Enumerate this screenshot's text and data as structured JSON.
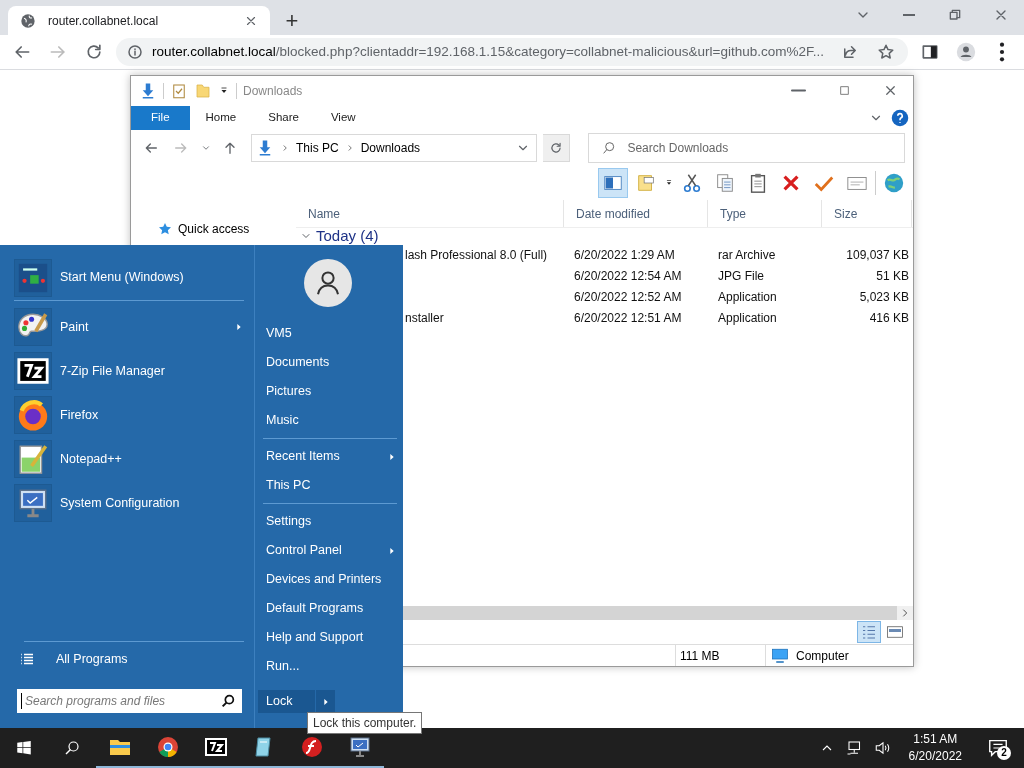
{
  "browser": {
    "tab_title": "router.collabnet.local",
    "new_tab": "+",
    "url_host": "router.collabnet.local",
    "url_path": "/blocked.php?clientaddr=192.168.1.15&category=collabnet-malicious&url=github.com%2F..."
  },
  "explorer": {
    "title": "Downloads",
    "ribbon_tabs": [
      {
        "label": "File",
        "selected": true
      },
      {
        "label": "Home",
        "selected": false
      },
      {
        "label": "Share",
        "selected": false
      },
      {
        "label": "View",
        "selected": false
      }
    ],
    "breadcrumb": [
      "This PC",
      "Downloads"
    ],
    "search": {
      "placeholder": "Search Downloads"
    },
    "preview_pane": {
      "on": true
    },
    "toolbar": [
      {
        "kind": "pane"
      },
      {
        "kind": "note"
      },
      {
        "kind": "cut"
      },
      {
        "kind": "copy"
      },
      {
        "kind": "paste"
      },
      {
        "kind": "delete"
      },
      {
        "kind": "check"
      },
      {
        "kind": "card"
      },
      {
        "kind": "globe"
      }
    ],
    "nav": [
      "Quick access"
    ],
    "columns": [
      "Name",
      "Date modified",
      "Type",
      "Size"
    ],
    "group": "Today (4)",
    "files": [
      {
        "name": "lash Professional 8.0 (Full)",
        "date": "6/20/2022 1:29 AM",
        "type": "rar Archive",
        "size": "109,037 KB"
      },
      {
        "date": "6/20/2022 12:54 AM",
        "type": "JPG File",
        "size": "51 KB"
      },
      {
        "date": "6/20/2022 12:52 AM",
        "type": "Application",
        "size": "5,023 KB"
      },
      {
        "name": "nstaller",
        "date": "6/20/2022 12:51 AM",
        "type": "Application",
        "size": "416 KB"
      }
    ],
    "views": [
      {
        "kind": "details",
        "selected": true
      },
      {
        "kind": "preview",
        "selected": false
      }
    ],
    "status": {
      "size": "111 MB",
      "zone": "Computer"
    }
  },
  "start_menu": {
    "pinned": [
      {
        "kind": "start",
        "label": "Start Menu (Windows)",
        "submenu": false,
        "separator_after": true
      },
      {
        "kind": "paint",
        "label": "Paint",
        "submenu": true,
        "separator_after": false
      },
      {
        "kind": "zip",
        "label": "7-Zip File Manager",
        "submenu": false,
        "separator_after": false
      },
      {
        "kind": "firefox",
        "label": "Firefox",
        "submenu": false,
        "separator_after": false
      },
      {
        "kind": "notepad",
        "label": "Notepad++",
        "submenu": false,
        "separator_after": false
      },
      {
        "kind": "sysconfig",
        "label": "System Configuration",
        "submenu": false,
        "separator_after": false
      }
    ],
    "all_programs": "All Programs",
    "search": {
      "placeholder": "Search programs and files"
    },
    "places": [
      {
        "label": "VM5",
        "submenu": false,
        "separator_before": false
      },
      {
        "label": "Documents",
        "submenu": false,
        "separator_before": false
      },
      {
        "label": "Pictures",
        "submenu": false,
        "separator_before": false
      },
      {
        "label": "Music",
        "submenu": false,
        "separator_before": false
      },
      {
        "label": "Recent Items",
        "submenu": true,
        "separator_before": true
      },
      {
        "label": "This PC",
        "submenu": false,
        "separator_before": false
      },
      {
        "label": "Settings",
        "submenu": false,
        "separator_before": true
      },
      {
        "label": "Control Panel",
        "submenu": true,
        "separator_before": false
      },
      {
        "label": "Devices and Printers",
        "submenu": false,
        "separator_before": false
      },
      {
        "label": "Default Programs",
        "submenu": false,
        "separator_before": false
      },
      {
        "label": "Help and Support",
        "submenu": false,
        "separator_before": false
      },
      {
        "label": "Run...",
        "submenu": false,
        "separator_before": false
      }
    ],
    "lock": {
      "label": "Lock"
    },
    "tooltip": "Lock this computer."
  },
  "taskbar": {
    "apps": [
      {
        "kind": "explorer",
        "running": true
      },
      {
        "kind": "chrome",
        "running": true
      },
      {
        "kind": "zip",
        "running": true
      },
      {
        "kind": "notepad",
        "running": true
      },
      {
        "kind": "flash",
        "running": true
      },
      {
        "kind": "sysconfig",
        "running": true
      }
    ],
    "time": "1:51 AM",
    "date": "6/20/2022",
    "notifications": "2"
  }
}
